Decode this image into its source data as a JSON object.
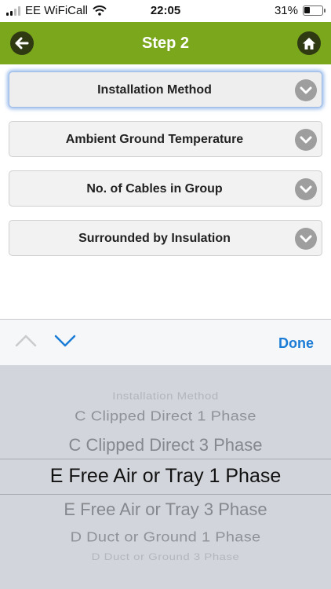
{
  "status_bar": {
    "carrier": "EE WiFiCall",
    "time": "22:05",
    "battery_percent_label": "31%",
    "battery_level": 0.31
  },
  "header": {
    "title": "Step 2",
    "back_icon": "arrow-left-icon",
    "home_icon": "home-icon",
    "accent_color": "#7aa71b"
  },
  "selectors": [
    {
      "label": "Installation Method",
      "focused": true
    },
    {
      "label": "Ambient Ground Temperature",
      "focused": false
    },
    {
      "label": "No. of Cables in Group",
      "focused": false
    },
    {
      "label": "Surrounded by Insulation",
      "focused": false
    }
  ],
  "accessory_bar": {
    "done_label": "Done",
    "prev_enabled": false,
    "next_enabled": true
  },
  "picker": {
    "options": [
      "Installation Method",
      "C Clipped Direct 1 Phase",
      "C Clipped Direct 3 Phase",
      "E Free Air or Tray 1 Phase",
      "E Free Air or Tray 3 Phase",
      "D Duct or Ground 1 Phase",
      "D Duct or Ground 3 Phase"
    ],
    "selected": "E Free Air or Tray 1 Phase"
  }
}
